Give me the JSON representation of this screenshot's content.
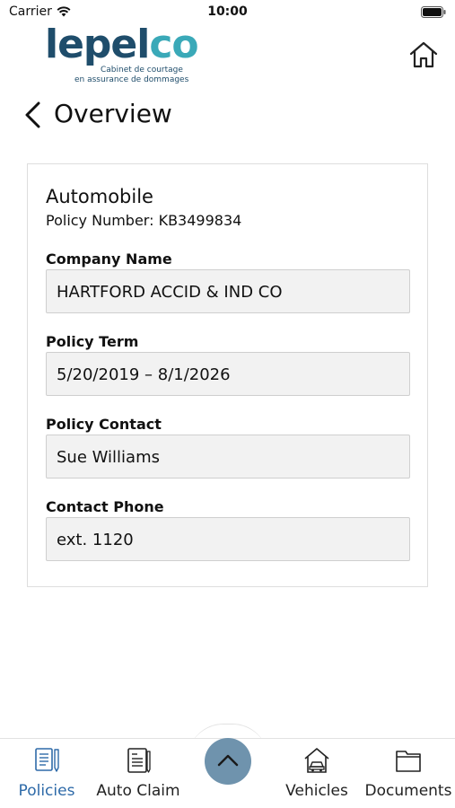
{
  "status_bar": {
    "carrier": "Carrier",
    "time": "10:00",
    "wifi_icon": "wifi-icon",
    "battery_icon": "battery-icon"
  },
  "header": {
    "logo": {
      "word_part1": "lepel",
      "word_part2": "co",
      "tagline_line1": "Cabinet de courtage",
      "tagline_line2": "en assurance de dommages",
      "brand_color_dark": "#1f4d6b",
      "brand_color_light": "#3aa9b8"
    },
    "home_icon": "home-icon",
    "back_icon": "chevron-left-icon",
    "title": "Overview"
  },
  "policy": {
    "type": "Automobile",
    "number_text": "Policy Number: KB3499834",
    "fields": [
      {
        "label": "Company Name",
        "value": "HARTFORD ACCID & IND CO"
      },
      {
        "label": "Policy Term",
        "value": "5/20/2019 – 8/1/2026"
      },
      {
        "label": "Policy Contact",
        "value": "Sue Williams"
      },
      {
        "label": "Contact Phone",
        "value": "ext. 1120"
      }
    ]
  },
  "tab_bar": {
    "active_color": "#2e6aa8",
    "fab_color": "#6f93ad",
    "fab_icon": "chevron-up-icon",
    "tabs": [
      {
        "label": "Policies",
        "icon": "policies-icon",
        "active": true
      },
      {
        "label": "Auto Claim",
        "icon": "auto-claim-icon",
        "active": false
      },
      {
        "label": "Vehicles",
        "icon": "vehicles-icon",
        "active": false
      },
      {
        "label": "Documents",
        "icon": "documents-icon",
        "active": false
      }
    ]
  }
}
